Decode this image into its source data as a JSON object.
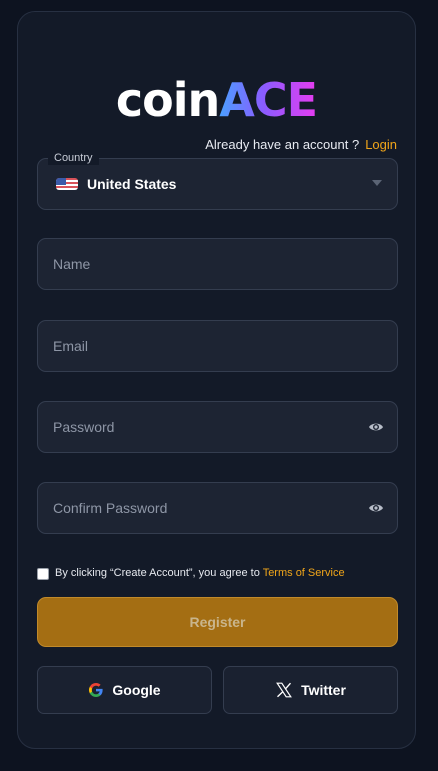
{
  "logo": {
    "part1": "coin",
    "part2": "ACE"
  },
  "signin_prompt": {
    "text": "Already have an account ?",
    "link": "Login"
  },
  "country": {
    "label": "Country",
    "value": "United States",
    "flag_icon": "us-flag-icon"
  },
  "fields": {
    "name_placeholder": "Name",
    "email_placeholder": "Email",
    "password_placeholder": "Password",
    "confirm_placeholder": "Confirm Password"
  },
  "terms": {
    "text": "By clicking “Create Account”, you agree to ",
    "link": "Terms of Service"
  },
  "register_label": "Register",
  "social": {
    "google_label": "Google",
    "twitter_label": "Twitter"
  },
  "colors": {
    "accent": "#f0a51a",
    "register_bg": "#a46e13",
    "card_bg": "#131a28",
    "page_bg": "#0d1320"
  }
}
